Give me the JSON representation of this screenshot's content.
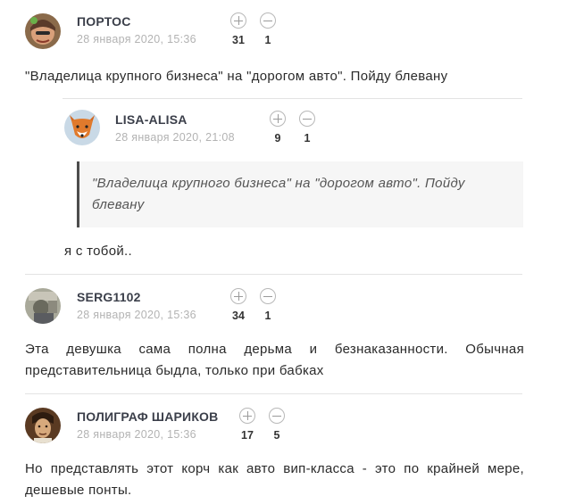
{
  "comments": [
    {
      "author": "ПОРТОС",
      "date": "28 января 2020, 15:36",
      "plus": "31",
      "minus": "1",
      "text": "\"Владелица крупного бизнеса\" на \"дорогом авто\". Пойду блевану"
    },
    {
      "author": "LISA-ALISA",
      "date": "28 января 2020, 21:08",
      "plus": "9",
      "minus": "1",
      "quote": "\"Владелица крупного бизнеса\" на \"дорогом авто\". Пойду блевану",
      "text": "я с тобой.."
    },
    {
      "author": "SERG1102",
      "date": "28 января 2020, 15:36",
      "plus": "34",
      "minus": "1",
      "text": "Эта девушка сама полна дерьма и безнаказанности. Обычная представительница быдла, только при бабках"
    },
    {
      "author": "ПОЛИГРАФ ШАРИКОВ",
      "date": "28 января 2020, 15:36",
      "plus": "17",
      "minus": "5",
      "text": "Но представлять этот корч как авто вип-класса - это по крайней мере, дешевые понты."
    }
  ],
  "icons": {
    "upvote": "plus-circle-icon",
    "downvote": "minus-circle-icon"
  },
  "colors": {
    "author": "#3b3f4a",
    "date": "#b3b3b3",
    "quote_bar": "#4d4d4d",
    "quote_bg": "#f6f6f6"
  }
}
